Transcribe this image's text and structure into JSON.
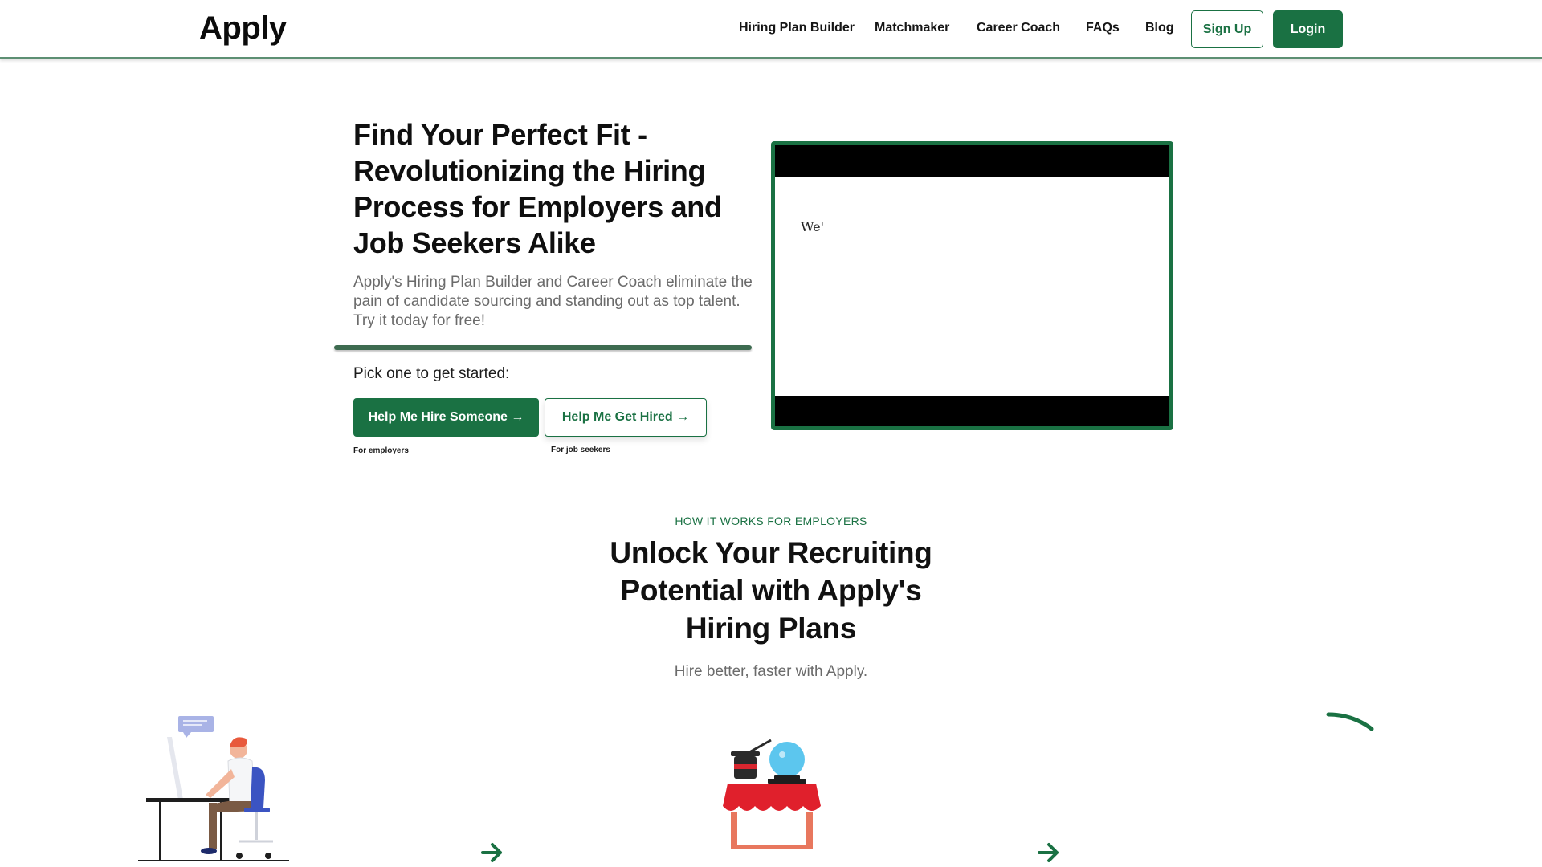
{
  "header": {
    "logo": "Apply",
    "nav": [
      "Hiring Plan Builder",
      "Matchmaker",
      "Career Coach",
      "FAQs",
      "Blog"
    ],
    "signup_label": "Sign Up",
    "login_label": "Login"
  },
  "hero": {
    "title": "Find Your Perfect Fit - Revolutionizing the Hiring Process for Employers and Job Seekers Alike",
    "subtitle": "Apply's Hiring Plan Builder and Career Coach eliminate the pain of candidate sourcing and standing out as top talent. Try it today for free!",
    "pick_label": "Pick one to get started:",
    "hire_button": "Help Me Hire Someone →",
    "hired_button": "Help Me Get Hired →",
    "hire_caption": "For employers",
    "hired_caption": "For job seekers",
    "video_text": "We'"
  },
  "how_it_works": {
    "eyebrow": "HOW IT WORKS FOR EMPLOYERS",
    "title": "Unlock Your Recruiting Potential with Apply's Hiring Plans",
    "subtitle": "Hire better, faster with Apply."
  },
  "colors": {
    "accent": "#1a7143",
    "text": "#111111",
    "muted": "#6b6b6b"
  },
  "icons": [
    "person-at-desk-illustration",
    "magic-hat-crystal-ball-illustration",
    "arrow-right-icon",
    "loading-arc-icon"
  ]
}
